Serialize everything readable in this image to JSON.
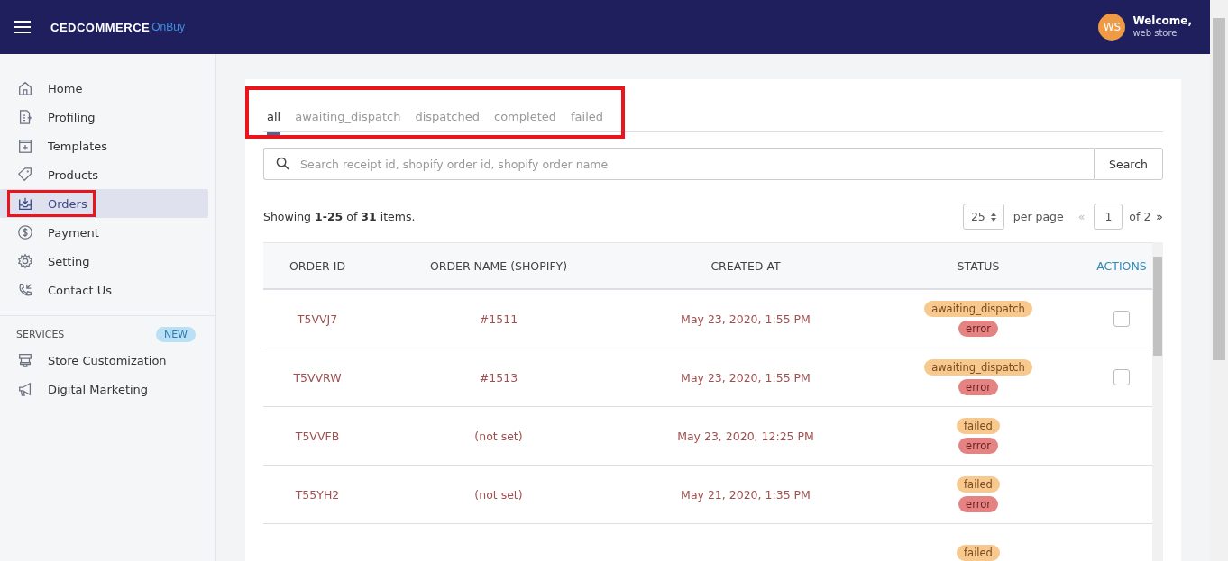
{
  "header": {
    "logo_main": "CEDCOMMERCE",
    "logo_sub": "OnBuy",
    "avatar": "WS",
    "welcome": "Welcome,",
    "user": "web store"
  },
  "sidebar": {
    "items": [
      {
        "label": "Home",
        "selected": false,
        "highlighted": false
      },
      {
        "label": "Profiling",
        "selected": false,
        "highlighted": false
      },
      {
        "label": "Templates",
        "selected": false,
        "highlighted": false
      },
      {
        "label": "Products",
        "selected": false,
        "highlighted": false
      },
      {
        "label": "Orders",
        "selected": true,
        "highlighted": true
      },
      {
        "label": "Payment",
        "selected": false,
        "highlighted": false
      },
      {
        "label": "Setting",
        "selected": false,
        "highlighted": false
      },
      {
        "label": "Contact Us",
        "selected": false,
        "highlighted": false
      }
    ],
    "services": {
      "label": "SERVICES",
      "badge": "NEW",
      "items": [
        {
          "label": "Store Customization",
          "selected": false
        },
        {
          "label": "Digital Marketing",
          "selected": false
        }
      ]
    }
  },
  "tabs_highlighted": true,
  "tabs": [
    {
      "label": "all",
      "selected": true
    },
    {
      "label": "awaiting_dispatch",
      "selected": false
    },
    {
      "label": "dispatched",
      "selected": false
    },
    {
      "label": "completed",
      "selected": false
    },
    {
      "label": "failed",
      "selected": false
    }
  ],
  "search": {
    "placeholder": "Search receipt id, shopify order id, shopify order name",
    "button": "Search"
  },
  "summary": "Showing **1-25** of **31** items.",
  "pagination": {
    "per_page": "25",
    "per_page_label": "per page",
    "prev": "«",
    "page": "1",
    "of": "of 2",
    "next": "»"
  },
  "table": {
    "columns": [
      "ORDER ID",
      "ORDER NAME (SHOPIFY)",
      "CREATED AT",
      "STATUS",
      "ACTIONS"
    ],
    "rows": [
      {
        "order_id": "T5VVJ7",
        "order_name": "#1511",
        "created_at": "May 23, 2020, 1:55 PM",
        "status": [
          {
            "label": "awaiting_dispatch",
            "kind": "state"
          },
          {
            "label": "error",
            "kind": "error"
          }
        ],
        "checkbox": {
          "checked": false
        }
      },
      {
        "order_id": "T5VVRW",
        "order_name": "#1513",
        "created_at": "May 23, 2020, 1:55 PM",
        "status": [
          {
            "label": "awaiting_dispatch",
            "kind": "state"
          },
          {
            "label": "error",
            "kind": "error"
          }
        ],
        "checkbox": {
          "checked": false
        }
      },
      {
        "order_id": "T5VVFB",
        "order_name": "(not set)",
        "created_at": "May 23, 2020, 12:25 PM",
        "status": [
          {
            "label": "failed",
            "kind": "state"
          },
          {
            "label": "error",
            "kind": "error"
          }
        ]
      },
      {
        "order_id": "T55YH2",
        "order_name": "(not set)",
        "created_at": "May 21, 2020, 1:35 PM",
        "status": [
          {
            "label": "failed",
            "kind": "state"
          },
          {
            "label": "error",
            "kind": "error"
          }
        ]
      },
      {
        "status": [
          {
            "label": "failed",
            "kind": "state"
          }
        ]
      }
    ]
  }
}
